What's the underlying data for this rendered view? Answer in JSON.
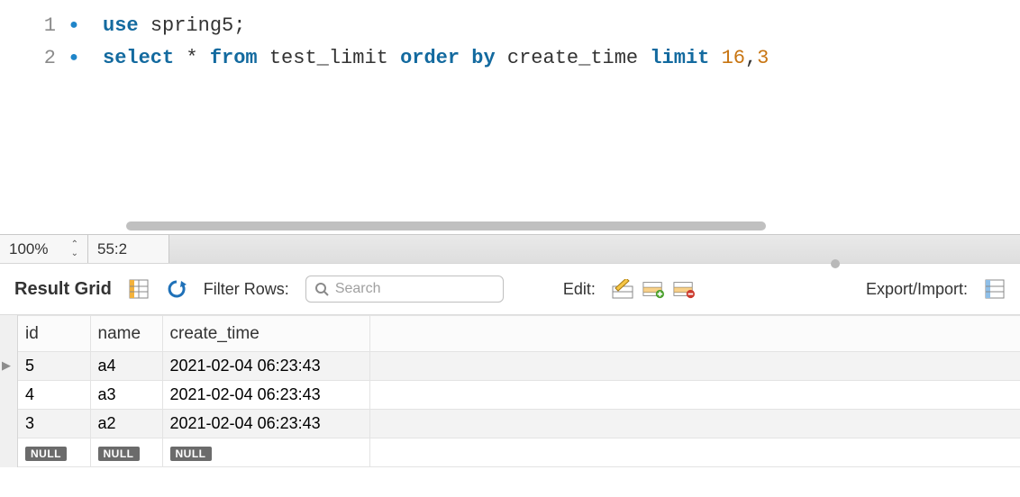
{
  "editor": {
    "lines": [
      {
        "no": "1",
        "tokens": [
          {
            "t": "use",
            "c": "kw"
          },
          {
            "t": " ",
            "c": "op"
          },
          {
            "t": "spring5",
            "c": "ident"
          },
          {
            "t": ";",
            "c": "punct"
          }
        ]
      },
      {
        "no": "2",
        "tokens": [
          {
            "t": "select",
            "c": "kw"
          },
          {
            "t": " * ",
            "c": "op"
          },
          {
            "t": "from",
            "c": "kw"
          },
          {
            "t": " ",
            "c": "op"
          },
          {
            "t": "test_limit",
            "c": "ident"
          },
          {
            "t": " ",
            "c": "op"
          },
          {
            "t": "order by",
            "c": "kw"
          },
          {
            "t": " ",
            "c": "op"
          },
          {
            "t": "create_time",
            "c": "ident"
          },
          {
            "t": " ",
            "c": "op"
          },
          {
            "t": "limit",
            "c": "kw"
          },
          {
            "t": " ",
            "c": "op"
          },
          {
            "t": "16",
            "c": "num"
          },
          {
            "t": ",",
            "c": "punct"
          },
          {
            "t": "3",
            "c": "num"
          }
        ]
      }
    ]
  },
  "status": {
    "zoom": "100%",
    "cursor": "55:2"
  },
  "toolbar": {
    "result_grid_label": "Result Grid",
    "filter_label": "Filter Rows:",
    "search_placeholder": "Search",
    "edit_label": "Edit:",
    "export_label": "Export/Import:"
  },
  "grid": {
    "columns": [
      "id",
      "name",
      "create_time"
    ],
    "rows": [
      {
        "id": "5",
        "name": "a4",
        "create_time": "2021-02-04 06:23:43",
        "current": true
      },
      {
        "id": "4",
        "name": "a3",
        "create_time": "2021-02-04 06:23:43",
        "current": false
      },
      {
        "id": "3",
        "name": "a2",
        "create_time": "2021-02-04 06:23:43",
        "current": false
      }
    ],
    "null_label": "NULL"
  }
}
